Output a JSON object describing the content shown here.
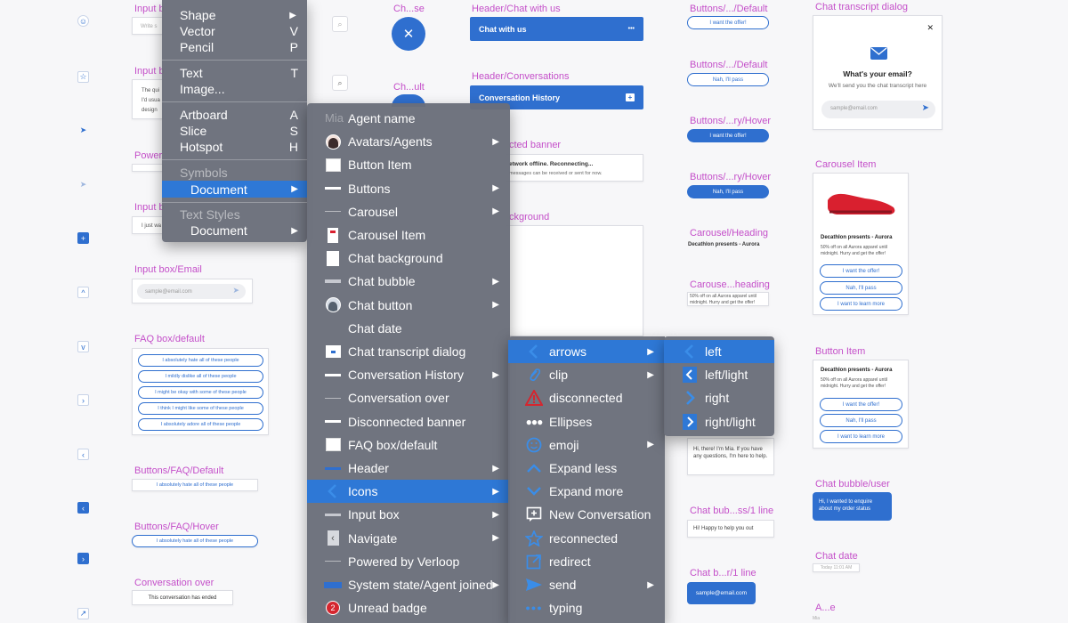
{
  "colors": {
    "accent": "#2f6fcf",
    "menu_bg": "#6a6e7a",
    "menu_selected": "#2e78d6",
    "label_magenta": "#c44fc9"
  },
  "labels": {
    "input_b1": "Input b",
    "input_b2": "Input b",
    "power": "Power",
    "input_b3": "Input b",
    "input_email": "Input box/Email",
    "faq_default": "FAQ box/default",
    "buttons_faq_default": "Buttons/FAQ/Default",
    "buttons_faq_hover": "Buttons/FAQ/Hover",
    "conversation_over": "Conversation over",
    "chase": "Ch...se",
    "chult": "Ch...ult",
    "header_chat": "Header/Chat with us",
    "header_conv": "Header/Conversations",
    "cted_banner": "cted banner",
    "ckground": "ckground",
    "buttons_default1": "Buttons/.../Default",
    "buttons_default2": "Buttons/.../Default",
    "buttons_hover1": "Buttons/...ry/Hover",
    "buttons_hover2": "Buttons/...ry/Hover",
    "carousel_heading": "Carousel/Heading",
    "carousel_subheading": "Carouse...heading",
    "chat_bubble_1line": "Chat bub...ss/1 line",
    "chat_bubble_r1line": "Chat b...r/1 line",
    "chat_transcript": "Chat transcript dialog",
    "carousel_item": "Carousel Item",
    "button_item": "Button Item",
    "chat_bubble_user": "Chat bubble/user",
    "chat_date": "Chat date",
    "ae": "A...e"
  },
  "canvas": {
    "input_placeholder_write": "Write s",
    "input_text_lines": [
      "The qui",
      "I'd usua",
      "design"
    ],
    "input_just": "I just wa",
    "email_placeholder": "sample@email.com",
    "faq_rows": [
      "I absolutely hate all of these people",
      "I mildly dislike all of these people",
      "I might be okay with some of these people",
      "I think I might like some of these people",
      "I absolutely adore all of these people"
    ],
    "faq_button_text": "I absolutely hate all of these people",
    "conversation_over_text": "This conversation has ended",
    "chat_with_us": "Chat with us",
    "header_dots": "•••",
    "conversation_history": "Conversation History",
    "banner_title": "etwork offline. Reconnecting...",
    "banner_sub": "messages can be received or sent for now.",
    "want_offer": "I want the offer!",
    "nah_pass": "Nah, I'll pass",
    "learn_more": "I want to learn more",
    "carousel_heading_text": "Decathlon presents - Aurora",
    "carousel_sub_text": "50% off on all Aurora apparel until midnight. Hurry and get the offer!",
    "mia_greeting": "Hi, there! I'm Mia. If you have any questions, I'm here to help.",
    "happy_help": "Hi! Happy to help you out",
    "user_email_bubble": "sample@email.com",
    "transcript_title": "What's your email?",
    "transcript_sub": "We'll send you the chat transcript here",
    "close_x": "✕",
    "user_bubble_text": "Hi, I  wanted to enquire about my order status",
    "chat_date_text": "Today 11:01 AM",
    "mia_small": "Mia"
  },
  "menu1": {
    "items": [
      {
        "label": "Shape",
        "shortcut": "▶"
      },
      {
        "label": "Vector",
        "shortcut": "V"
      },
      {
        "label": "Pencil",
        "shortcut": "P"
      },
      {
        "label": "Text",
        "shortcut": "T"
      },
      {
        "label": "Image...",
        "shortcut": ""
      },
      {
        "label": "Artboard",
        "shortcut": "A"
      },
      {
        "label": "Slice",
        "shortcut": "S"
      },
      {
        "label": "Hotspot",
        "shortcut": "H"
      }
    ],
    "symbols_header": "Symbols",
    "symbols_document": "Document",
    "text_styles_header": "Text Styles",
    "text_styles_document": "Document",
    "arrow": "▶"
  },
  "menu2": {
    "header": "Mia",
    "items": [
      {
        "label": "Agent name",
        "icon": "blank-icon",
        "submenu": false
      },
      {
        "label": "Avatars/Agents",
        "icon": "avatar-female-icon",
        "submenu": true
      },
      {
        "label": "Button Item",
        "icon": "document-thumb-icon",
        "submenu": false
      },
      {
        "label": "Buttons",
        "icon": "line-thumb-icon",
        "submenu": true
      },
      {
        "label": "Carousel",
        "icon": "thin-line-icon",
        "submenu": true
      },
      {
        "label": "Carousel Item",
        "icon": "carousel-thumb-icon",
        "submenu": false
      },
      {
        "label": "Chat background",
        "icon": "white-page-icon",
        "submenu": false
      },
      {
        "label": "Chat bubble",
        "icon": "gray-bar-icon",
        "submenu": true
      },
      {
        "label": "Chat button",
        "icon": "avatar-male-icon",
        "submenu": true
      },
      {
        "label": "Chat date",
        "icon": "blank-icon",
        "submenu": false
      },
      {
        "label": "Chat transcript dialog",
        "icon": "dialog-thumb-icon",
        "submenu": false
      },
      {
        "label": "Conversation History",
        "icon": "line-thumb-icon",
        "submenu": true
      },
      {
        "label": "Conversation over",
        "icon": "thin-line-icon",
        "submenu": false
      },
      {
        "label": "Disconnected banner",
        "icon": "line-thumb-icon",
        "submenu": false
      },
      {
        "label": "FAQ box/default",
        "icon": "document-thumb-icon",
        "submenu": false
      },
      {
        "label": "Header",
        "icon": "blue-line-icon",
        "submenu": true
      },
      {
        "label": "Icons",
        "icon": "chevron-left-icon",
        "submenu": true
      },
      {
        "label": "Input box",
        "icon": "gray-line-icon",
        "submenu": true
      },
      {
        "label": "Navigate",
        "icon": "navigate-thumb-icon",
        "submenu": true
      },
      {
        "label": "Powered by Verloop",
        "icon": "thin-line-icon",
        "submenu": false
      },
      {
        "label": "System state/Agent joined",
        "icon": "blue-badge-thumb-icon",
        "submenu": true
      },
      {
        "label": "Unread badge",
        "icon": "red-badge-icon",
        "submenu": false
      }
    ],
    "badge_number": "2",
    "arrow": "▶"
  },
  "menu3": {
    "items": [
      {
        "label": "arrows",
        "icon": "chevron-left-icon",
        "submenu": true
      },
      {
        "label": "clip",
        "icon": "paperclip-icon",
        "submenu": true
      },
      {
        "label": "disconnected",
        "icon": "warning-icon",
        "submenu": false
      },
      {
        "label": "Ellipses",
        "icon": "ellipsis-icon",
        "submenu": false
      },
      {
        "label": "emoji",
        "icon": "emoji-icon",
        "submenu": true
      },
      {
        "label": "Expand less",
        "icon": "chevron-up-icon",
        "submenu": false
      },
      {
        "label": "Expand more",
        "icon": "chevron-down-icon",
        "submenu": false
      },
      {
        "label": "New Conversation",
        "icon": "new-conversation-icon",
        "submenu": false
      },
      {
        "label": "reconnected",
        "icon": "star-icon",
        "submenu": false
      },
      {
        "label": "redirect",
        "icon": "redirect-icon",
        "submenu": false
      },
      {
        "label": "send",
        "icon": "send-icon",
        "submenu": true
      },
      {
        "label": "typing",
        "icon": "typing-dots-icon",
        "submenu": false
      }
    ],
    "arrow": "▶"
  },
  "menu4": {
    "items": [
      {
        "label": "left",
        "icon": "chevron-left-icon"
      },
      {
        "label": "left/light",
        "icon": "chevron-left-boxed-icon"
      },
      {
        "label": "right",
        "icon": "chevron-right-icon"
      },
      {
        "label": "right/light",
        "icon": "chevron-right-boxed-icon"
      }
    ]
  }
}
